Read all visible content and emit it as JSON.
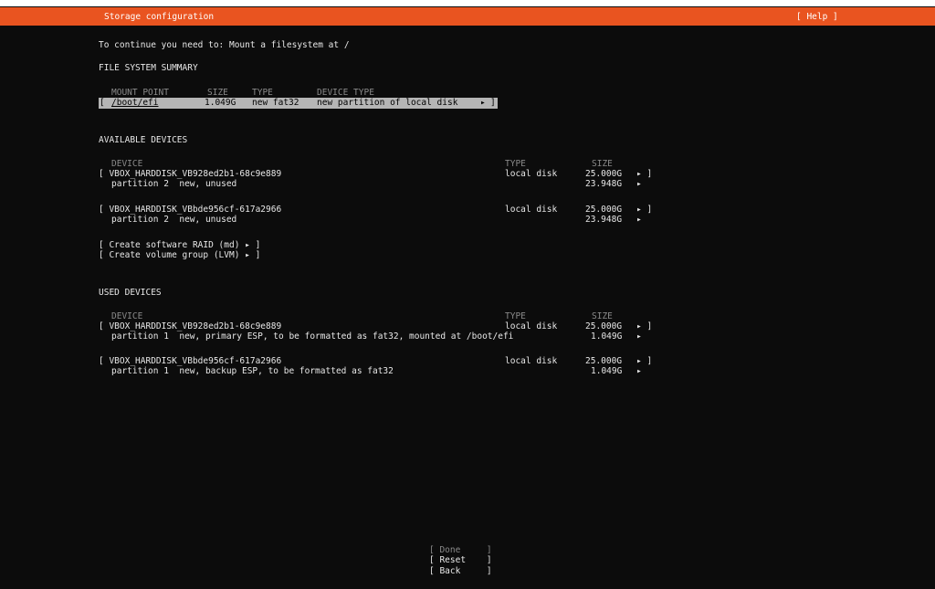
{
  "header": {
    "title": "Storage configuration",
    "help": "[ Help ]"
  },
  "instruction": "To continue you need to: Mount a filesystem at /",
  "fs_summary": {
    "heading": "FILE SYSTEM SUMMARY",
    "columns": [
      "MOUNT POINT",
      "SIZE",
      "TYPE",
      "DEVICE TYPE"
    ],
    "rows": [
      {
        "open": "[",
        "mount": "/boot/efi",
        "size": "1.049G",
        "type": "new fat32",
        "device_type": "new partition of local disk",
        "arrow": "▸",
        "close": "]"
      }
    ]
  },
  "available": {
    "heading": "AVAILABLE DEVICES",
    "col_device": "DEVICE",
    "col_type": "TYPE",
    "col_size": "SIZE",
    "disks": [
      {
        "name": "[ VBOX_HARDDISK_VB928ed2b1-68c9e889",
        "type": "local disk",
        "size": "25.000G",
        "arrow": "▸ ]",
        "partition": "partition 2  new, unused",
        "part_size": "23.948G",
        "part_arrow": "▸"
      },
      {
        "name": "[ VBOX_HARDDISK_VBbde956cf-617a2966",
        "type": "local disk",
        "size": "25.000G",
        "arrow": "▸ ]",
        "partition": "partition 2  new, unused",
        "part_size": "23.948G",
        "part_arrow": "▸"
      }
    ],
    "actions": [
      "[ Create software RAID (md) ▸ ]",
      "[ Create volume group (LVM) ▸ ]"
    ]
  },
  "used": {
    "heading": "USED DEVICES",
    "col_device": "DEVICE",
    "col_type": "TYPE",
    "col_size": "SIZE",
    "disks": [
      {
        "name": "[ VBOX_HARDDISK_VB928ed2b1-68c9e889",
        "type": "local disk",
        "size": "25.000G",
        "arrow": "▸ ]",
        "partition": "partition 1  new, primary ESP, to be formatted as fat32, mounted at /boot/efi",
        "part_size": "1.049G",
        "part_arrow": "▸"
      },
      {
        "name": "[ VBOX_HARDDISK_VBbde956cf-617a2966",
        "type": "local disk",
        "size": "25.000G",
        "arrow": "▸ ]",
        "partition": "partition 1  new, backup ESP, to be formatted as fat32",
        "part_size": "1.049G",
        "part_arrow": "▸"
      }
    ]
  },
  "buttons": {
    "done": "[ Done     ]",
    "reset": "[ Reset    ]",
    "back": "[ Back     ]"
  },
  "colors": {
    "accent": "#e95420",
    "background": "#0c0c0c",
    "selection": "#b5b5b5"
  }
}
